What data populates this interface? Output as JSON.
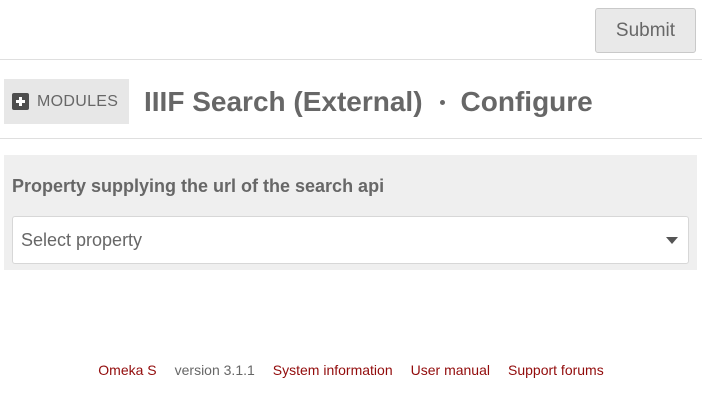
{
  "toolbar": {
    "submit_label": "Submit"
  },
  "header": {
    "modules_label": "MODULES",
    "title": "IIIF Search (External)",
    "action": "Configure"
  },
  "form": {
    "field_label": "Property supplying the url of the search api",
    "select_value": "Select property"
  },
  "footer": {
    "omeka_link": "Omeka S",
    "version": "version 3.1.1",
    "system_info_link": "System information",
    "user_manual_link": "User manual",
    "support_forums_link": "Support forums"
  },
  "colors": {
    "link": "#920b0b",
    "text": "#676767",
    "panel_bg": "#efefef",
    "button_bg": "#e9e9e9"
  }
}
